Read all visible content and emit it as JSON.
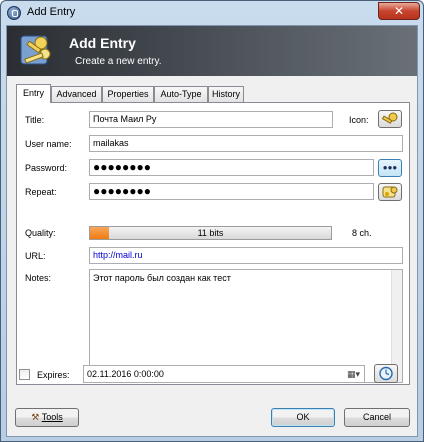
{
  "window": {
    "title": "Add Entry",
    "close_glyph": "✕"
  },
  "banner": {
    "title": "Add Entry",
    "subtitle": "Create a new entry."
  },
  "tabs": [
    {
      "label": "Entry",
      "active": true
    },
    {
      "label": "Advanced"
    },
    {
      "label": "Properties"
    },
    {
      "label": "Auto-Type"
    },
    {
      "label": "History"
    }
  ],
  "form": {
    "title_label": "Title:",
    "title_value": "Почта Маил Ру",
    "icon_label": "Icon:",
    "username_label": "User name:",
    "username_value": "mailakas",
    "password_label": "Password:",
    "password_value": "●●●●●●●●",
    "show_password_glyph": "●●●",
    "repeat_label": "Repeat:",
    "repeat_value": "●●●●●●●●",
    "quality_label": "Quality:",
    "quality_text": "11 bits",
    "quality_fraction": 0.08,
    "quality_chars": "8 ch.",
    "url_label": "URL:",
    "url_value": "http://mail.ru",
    "notes_label": "Notes:",
    "notes_value": "Этот пароль был создан как тест",
    "expires_label": "Expires:",
    "expires_checked": false,
    "expires_value": "02.11.2016   0:00:00"
  },
  "buttons": {
    "tools": "Tools",
    "ok": "OK",
    "cancel": "Cancel"
  },
  "icons": {
    "window": "lock-icon",
    "banner": "keys-icon",
    "entry_icon": "key-icon",
    "show_password": "dots-icon",
    "generate": "password-generator-icon",
    "calendar": "calendar-dropdown-icon",
    "clock": "clock-icon",
    "tools": "wrench-icon"
  },
  "colors": {
    "accent_orange": "#ee7c12",
    "url_blue": "#0000d0",
    "banner_dark": "#2a2e33"
  }
}
